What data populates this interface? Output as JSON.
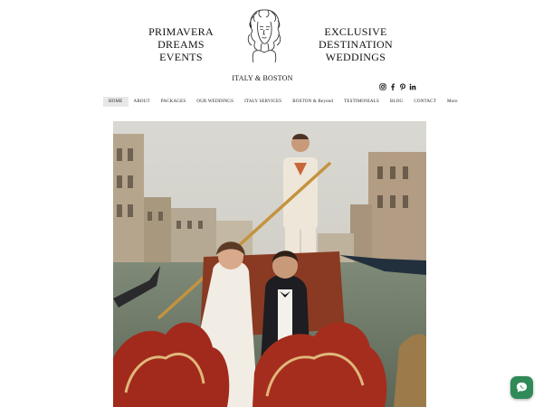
{
  "header": {
    "brand_line1": "PRIMAVERA DREAMS",
    "brand_line2": "EVENTS",
    "tagline_line1": "EXCLUSIVE DESTINATION",
    "tagline_line2": "WEDDINGS",
    "location": "ITALY & BOSTON",
    "logo_icon": "woman-portrait-logo-icon"
  },
  "social": [
    {
      "name": "instagram-icon"
    },
    {
      "name": "facebook-icon"
    },
    {
      "name": "pinterest-icon"
    },
    {
      "name": "linkedin-icon"
    }
  ],
  "nav": {
    "items": [
      {
        "label": "HOME",
        "active": true
      },
      {
        "label": "ABOUT"
      },
      {
        "label": "PACKAGES"
      },
      {
        "label": "OUR WEDDINGS"
      },
      {
        "label": "ITALY SERVICES"
      },
      {
        "label": "BOSTON & Beyond"
      },
      {
        "label": "TESTIMONIALS"
      },
      {
        "label": "BLOG"
      },
      {
        "label": "CONTACT"
      },
      {
        "label": "More"
      }
    ]
  },
  "hero": {
    "image": "couple-in-gondola-venice-photo"
  },
  "chat": {
    "icon": "chat-bubble-icon",
    "color": "#2f8a57"
  }
}
